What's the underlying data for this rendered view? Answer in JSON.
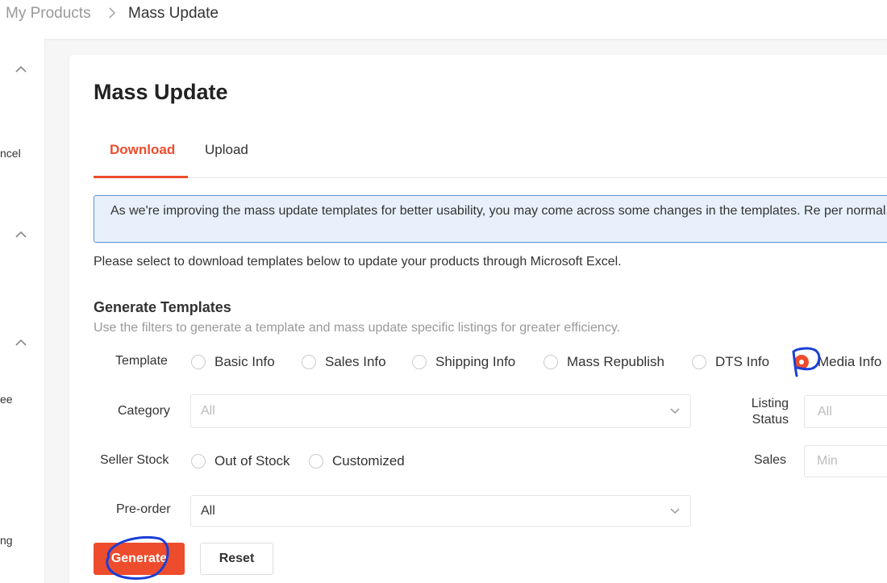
{
  "breadcrumb": {
    "root": "My Products",
    "current": "Mass Update"
  },
  "sidebar": {
    "items": [
      {
        "label": "ncel"
      },
      {
        "label": "ee"
      },
      {
        "label": "ng"
      }
    ]
  },
  "page": {
    "title": "Mass Update"
  },
  "tabs": [
    {
      "label": "Download",
      "active": true
    },
    {
      "label": "Upload",
      "active": false
    }
  ],
  "notice": {
    "text": "As we're improving the mass update templates for better usability, you may come across some changes in the templates. Re per normal."
  },
  "instruction": "Please select to download templates below to update your products through Microsoft Excel.",
  "generate_section": {
    "title": "Generate Templates",
    "subtitle": "Use the filters to generate a template and mass update specific listings for greater efficiency."
  },
  "filters": {
    "template": {
      "label": "Template",
      "options": [
        {
          "label": "Basic Info",
          "selected": false
        },
        {
          "label": "Sales Info",
          "selected": false
        },
        {
          "label": "Shipping Info",
          "selected": false
        },
        {
          "label": "Mass Republish",
          "selected": false
        },
        {
          "label": "DTS Info",
          "selected": false
        },
        {
          "label": "Media Info",
          "selected": true
        }
      ]
    },
    "category": {
      "label": "Category",
      "value": "All"
    },
    "listing_status": {
      "label_line1": "Listing",
      "label_line2": "Status",
      "value": "All"
    },
    "seller_stock": {
      "label": "Seller Stock",
      "options": [
        {
          "label": "Out of Stock",
          "selected": false
        },
        {
          "label": "Customized",
          "selected": false
        }
      ]
    },
    "sales": {
      "label": "Sales",
      "min_placeholder": "Min"
    },
    "pre_order": {
      "label": "Pre-order",
      "value": "All"
    }
  },
  "actions": {
    "generate_label": "Generate",
    "reset_label": "Reset"
  },
  "colors": {
    "accent": "#ee4d2d",
    "notice_bg": "#e8f1fb",
    "notice_border": "#5f8ed1",
    "annotation": "#1a3fd6"
  }
}
